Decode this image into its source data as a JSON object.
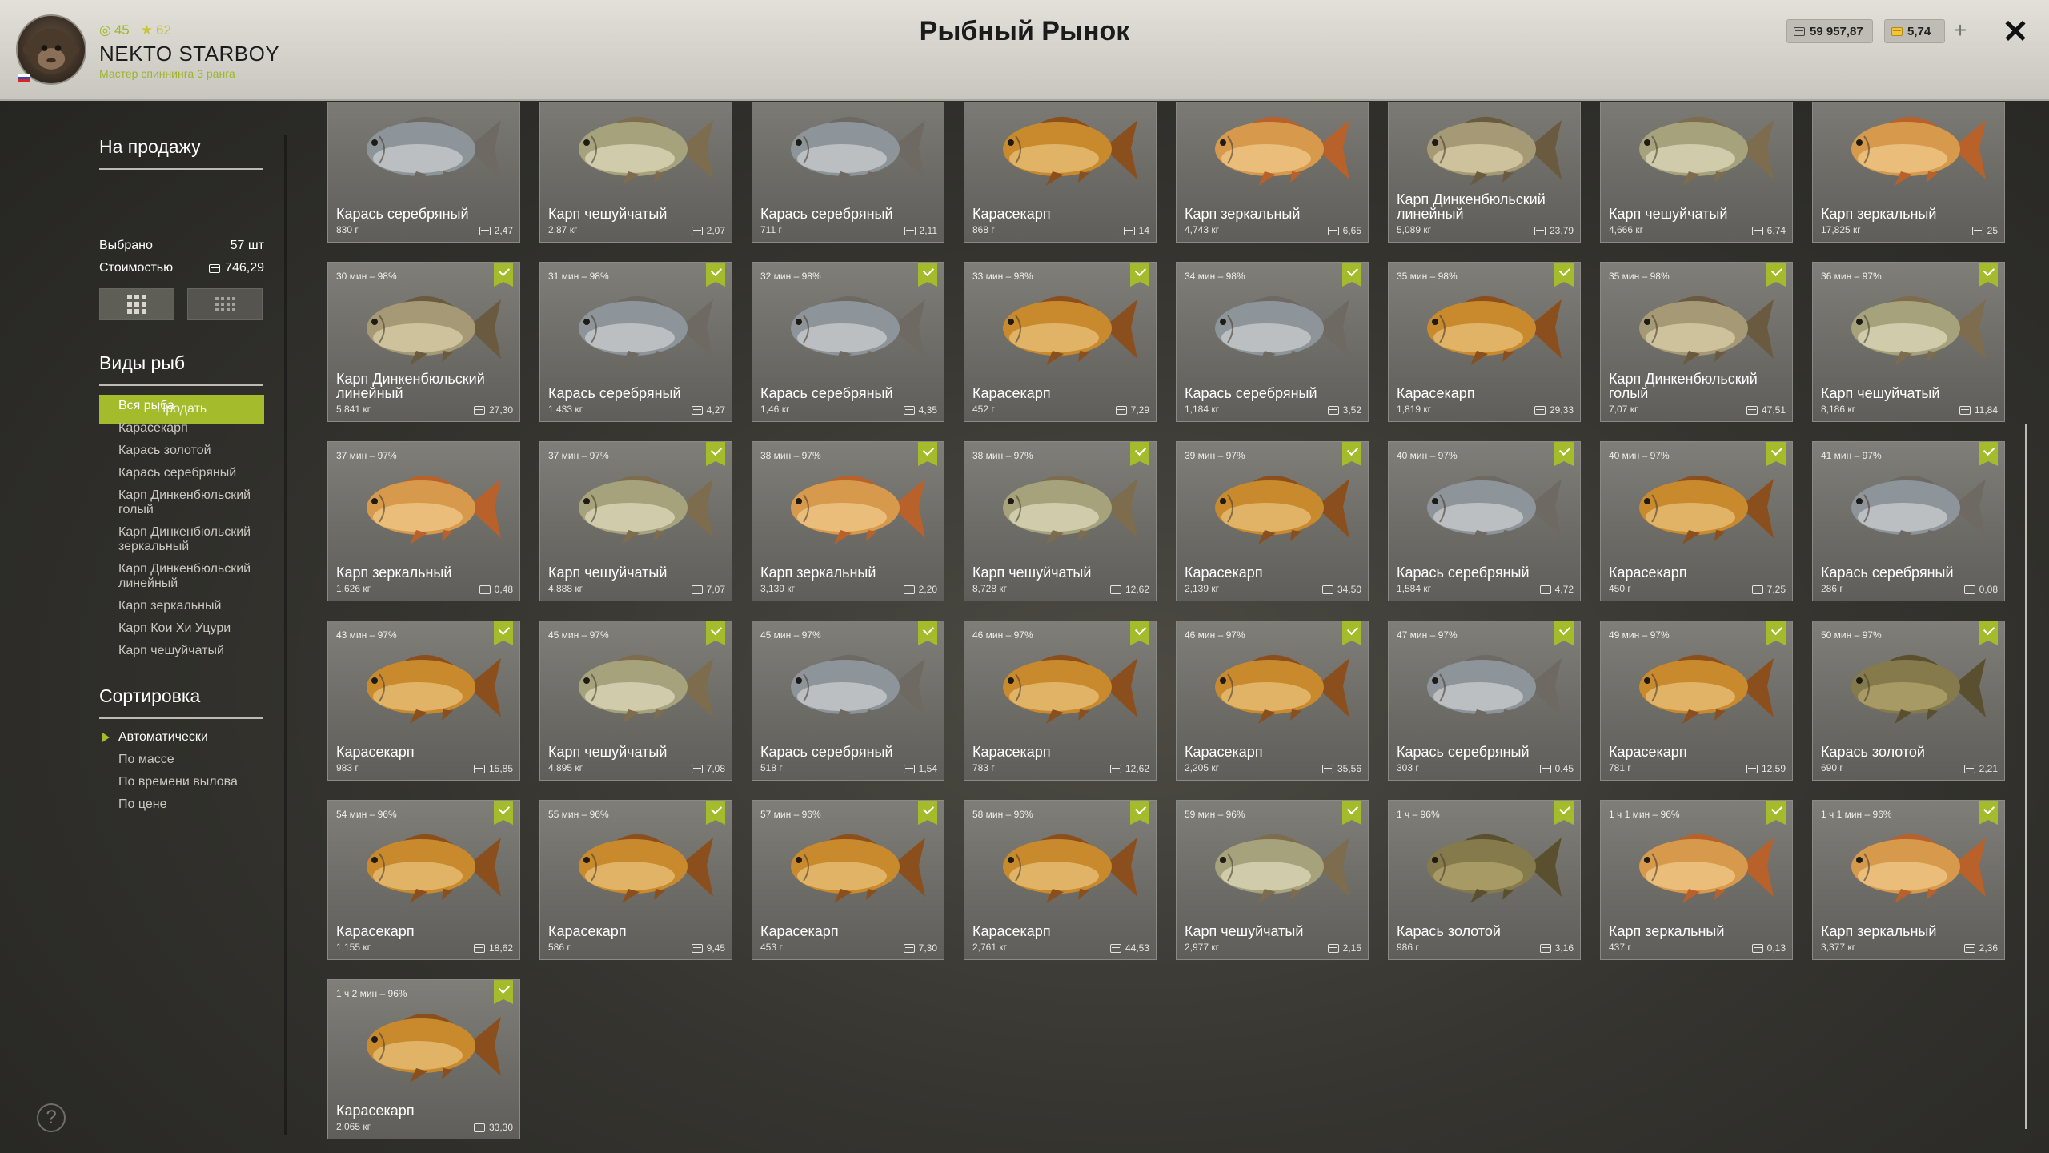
{
  "header": {
    "title": "Рыбный Рынок",
    "player": {
      "name": "NEKTO STARBOY",
      "rank": "Мастер спиннинга 3 ранга",
      "level_green": "45",
      "level_star": "62"
    },
    "currency": {
      "silver": "59 957,87",
      "gold": "5,74",
      "add": "+"
    },
    "close": "✕"
  },
  "sidebar": {
    "for_sale_title": "На продажу",
    "selected_label": "Выбрано",
    "selected_value": "57 шт",
    "cost_label": "Стоимостью",
    "cost_value": "746,29",
    "sell_button": "Продать",
    "fish_types_title": "Виды рыб",
    "fish_types": [
      "Вся рыба",
      "Карасекарп",
      "Карась золотой",
      "Карась серебряный",
      "Карп Динкенбюльский голый",
      "Карп Динкенбюльский зеркальный",
      "Карп Динкенбюльский линейный",
      "Карп зеркальный",
      "Карп Кои Хи Уцури",
      "Карп чешуйчатый"
    ],
    "sort_title": "Сортировка",
    "sort_options": [
      "Автоматически",
      "По массе",
      "По времени вылова",
      "По цене"
    ],
    "help": "?"
  },
  "colors": {
    "accent": "#a4bc2b",
    "header_bg": "#d6d4cd",
    "card_bg": "#74736e"
  },
  "cards": [
    {
      "time": "",
      "name": "Карась серебряный",
      "weight": "830 г",
      "price": "2,47",
      "checked": false,
      "kind": "silver"
    },
    {
      "time": "",
      "name": "Карп чешуйчатый",
      "weight": "2,87 кг",
      "price": "2,07",
      "checked": false,
      "kind": "scaly"
    },
    {
      "time": "",
      "name": "Карась серебряный",
      "weight": "711 г",
      "price": "2,11",
      "checked": false,
      "kind": "silver"
    },
    {
      "time": "",
      "name": "Карасекарп",
      "weight": "868 г",
      "price": "14",
      "checked": false,
      "kind": "golden"
    },
    {
      "time": "",
      "name": "Карп зеркальный",
      "weight": "4,743 кг",
      "price": "6,65",
      "checked": false,
      "kind": "mirror"
    },
    {
      "time": "",
      "name": "Карп Динкенбюльский линейный",
      "weight": "5,089 кг",
      "price": "23,79",
      "checked": false,
      "kind": "linear"
    },
    {
      "time": "",
      "name": "Карп чешуйчатый",
      "weight": "4,666 кг",
      "price": "6,74",
      "checked": false,
      "kind": "scaly"
    },
    {
      "time": "",
      "name": "Карп зеркальный",
      "weight": "17,825 кг",
      "price": "25",
      "checked": false,
      "kind": "mirror"
    },
    {
      "time": "30 мин – 98%",
      "name": "Карп Динкенбюльский линейный",
      "weight": "5,841 кг",
      "price": "27,30",
      "checked": true,
      "kind": "linear"
    },
    {
      "time": "31 мин – 98%",
      "name": "Карась серебряный",
      "weight": "1,433 кг",
      "price": "4,27",
      "checked": true,
      "kind": "silver"
    },
    {
      "time": "32 мин – 98%",
      "name": "Карась серебряный",
      "weight": "1,46 кг",
      "price": "4,35",
      "checked": true,
      "kind": "silver"
    },
    {
      "time": "33 мин – 98%",
      "name": "Карасекарп",
      "weight": "452 г",
      "price": "7,29",
      "checked": true,
      "kind": "golden"
    },
    {
      "time": "34 мин – 98%",
      "name": "Карась серебряный",
      "weight": "1,184 кг",
      "price": "3,52",
      "checked": true,
      "kind": "silver"
    },
    {
      "time": "35 мин – 98%",
      "name": "Карасекарп",
      "weight": "1,819 кг",
      "price": "29,33",
      "checked": true,
      "kind": "golden"
    },
    {
      "time": "35 мин – 98%",
      "name": "Карп Динкенбюльский голый",
      "weight": "7,07 кг",
      "price": "47,51",
      "checked": true,
      "kind": "linear"
    },
    {
      "time": "36 мин – 97%",
      "name": "Карп чешуйчатый",
      "weight": "8,186 кг",
      "price": "11,84",
      "checked": true,
      "kind": "scaly"
    },
    {
      "time": "37 мин – 97%",
      "name": "Карп зеркальный",
      "weight": "1,626 кг",
      "price": "0,48",
      "checked": false,
      "kind": "mirror"
    },
    {
      "time": "37 мин – 97%",
      "name": "Карп чешуйчатый",
      "weight": "4,888 кг",
      "price": "7,07",
      "checked": true,
      "kind": "scaly"
    },
    {
      "time": "38 мин – 97%",
      "name": "Карп зеркальный",
      "weight": "3,139 кг",
      "price": "2,20",
      "checked": true,
      "kind": "mirror"
    },
    {
      "time": "38 мин – 97%",
      "name": "Карп чешуйчатый",
      "weight": "8,728 кг",
      "price": "12,62",
      "checked": true,
      "kind": "scaly"
    },
    {
      "time": "39 мин – 97%",
      "name": "Карасекарп",
      "weight": "2,139 кг",
      "price": "34,50",
      "checked": true,
      "kind": "golden"
    },
    {
      "time": "40 мин – 97%",
      "name": "Карась серебряный",
      "weight": "1,584 кг",
      "price": "4,72",
      "checked": true,
      "kind": "silver"
    },
    {
      "time": "40 мин – 97%",
      "name": "Карасекарп",
      "weight": "450 г",
      "price": "7,25",
      "checked": true,
      "kind": "golden"
    },
    {
      "time": "41 мин – 97%",
      "name": "Карась серебряный",
      "weight": "286 г",
      "price": "0,08",
      "checked": true,
      "kind": "silver"
    },
    {
      "time": "43 мин – 97%",
      "name": "Карасекарп",
      "weight": "983 г",
      "price": "15,85",
      "checked": true,
      "kind": "golden"
    },
    {
      "time": "45 мин – 97%",
      "name": "Карп чешуйчатый",
      "weight": "4,895 кг",
      "price": "7,08",
      "checked": true,
      "kind": "scaly"
    },
    {
      "time": "45 мин – 97%",
      "name": "Карась серебряный",
      "weight": "518 г",
      "price": "1,54",
      "checked": true,
      "kind": "silver"
    },
    {
      "time": "46 мин – 97%",
      "name": "Карасекарп",
      "weight": "783 г",
      "price": "12,62",
      "checked": true,
      "kind": "golden"
    },
    {
      "time": "46 мин – 97%",
      "name": "Карасекарп",
      "weight": "2,205 кг",
      "price": "35,56",
      "checked": true,
      "kind": "golden"
    },
    {
      "time": "47 мин – 97%",
      "name": "Карась серебряный",
      "weight": "303 г",
      "price": "0,45",
      "checked": true,
      "kind": "silver"
    },
    {
      "time": "49 мин – 97%",
      "name": "Карасекарп",
      "weight": "781 г",
      "price": "12,59",
      "checked": true,
      "kind": "golden"
    },
    {
      "time": "50 мин – 97%",
      "name": "Карась золотой",
      "weight": "690 г",
      "price": "2,21",
      "checked": true,
      "kind": "goldcrucian"
    },
    {
      "time": "54 мин – 96%",
      "name": "Карасекарп",
      "weight": "1,155 кг",
      "price": "18,62",
      "checked": true,
      "kind": "golden"
    },
    {
      "time": "55 мин – 96%",
      "name": "Карасекарп",
      "weight": "586 г",
      "price": "9,45",
      "checked": true,
      "kind": "golden"
    },
    {
      "time": "57 мин – 96%",
      "name": "Карасекарп",
      "weight": "453 г",
      "price": "7,30",
      "checked": true,
      "kind": "golden"
    },
    {
      "time": "58 мин – 96%",
      "name": "Карасекарп",
      "weight": "2,761 кг",
      "price": "44,53",
      "checked": true,
      "kind": "golden"
    },
    {
      "time": "59 мин – 96%",
      "name": "Карп чешуйчатый",
      "weight": "2,977 кг",
      "price": "2,15",
      "checked": true,
      "kind": "scaly"
    },
    {
      "time": "1 ч – 96%",
      "name": "Карась золотой",
      "weight": "986 г",
      "price": "3,16",
      "checked": true,
      "kind": "goldcrucian"
    },
    {
      "time": "1 ч 1 мин – 96%",
      "name": "Карп зеркальный",
      "weight": "437 г",
      "price": "0,13",
      "checked": true,
      "kind": "mirror"
    },
    {
      "time": "1 ч 1 мин – 96%",
      "name": "Карп зеркальный",
      "weight": "3,377 кг",
      "price": "2,36",
      "checked": true,
      "kind": "mirror"
    },
    {
      "time": "1 ч 2 мин – 96%",
      "name": "Карасекарп",
      "weight": "2,065 кг",
      "price": "33,30",
      "checked": true,
      "kind": "golden"
    }
  ],
  "fish_colors": {
    "silver": {
      "body": "#8e959a",
      "belly": "#c9cdcf",
      "fin": "#6e6a63"
    },
    "scaly": {
      "body": "#a6a27c",
      "belly": "#dcd8bb",
      "fin": "#7d6c4d"
    },
    "golden": {
      "body": "#c98a2e",
      "belly": "#e8c07a",
      "fin": "#8a4f1c"
    },
    "mirror": {
      "body": "#d79a4d",
      "belly": "#f0c98a",
      "fin": "#b8612b"
    },
    "linear": {
      "body": "#a69a76",
      "belly": "#d9cfaa",
      "fin": "#6a5a3f"
    },
    "goldcrucian": {
      "body": "#857a4c",
      "belly": "#b3a66e",
      "fin": "#5a4f2f"
    }
  }
}
